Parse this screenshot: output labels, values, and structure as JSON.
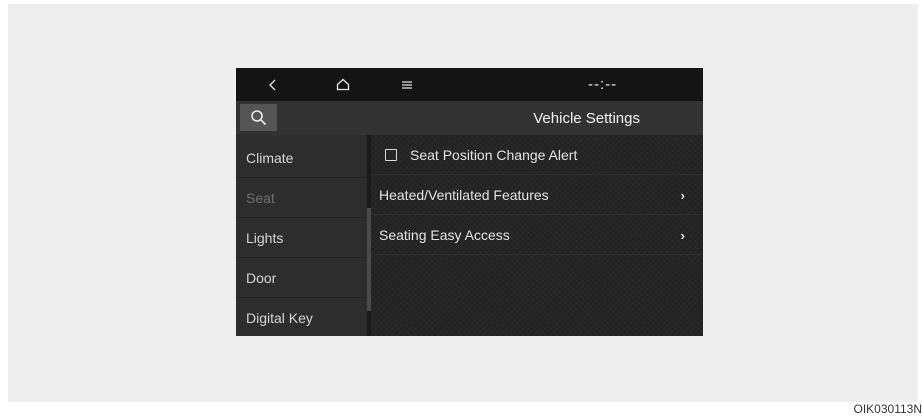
{
  "statusbar": {
    "back_icon": "chevron-left-icon",
    "home_icon": "home-icon",
    "menu_icon": "hamburger-menu-icon",
    "clock": "--:--"
  },
  "titlebar": {
    "search_icon": "search-icon",
    "title": "Vehicle Settings"
  },
  "sidebar": {
    "items": [
      {
        "label": "Climate",
        "active": false
      },
      {
        "label": "Seat",
        "active": true
      },
      {
        "label": "Lights",
        "active": false
      },
      {
        "label": "Door",
        "active": false
      },
      {
        "label": "Digital Key",
        "active": false
      }
    ]
  },
  "content": {
    "rows": [
      {
        "label": "Seat Position Change Alert",
        "type": "checkbox",
        "checked": false
      },
      {
        "label": "Heated/Ventilated Features",
        "type": "submenu",
        "chevron": "›"
      },
      {
        "label": "Seating Easy Access",
        "type": "submenu",
        "chevron": "›"
      }
    ]
  },
  "image_code": "OIK030113N",
  "colors": {
    "screen_bg": "#222222",
    "statusbar_bg": "#141414",
    "titlebar_bg": "#323232",
    "sidebar_bg": "#2d2d2d",
    "text": "#e4e4e4",
    "inactive_text": "#6f6f6f"
  }
}
